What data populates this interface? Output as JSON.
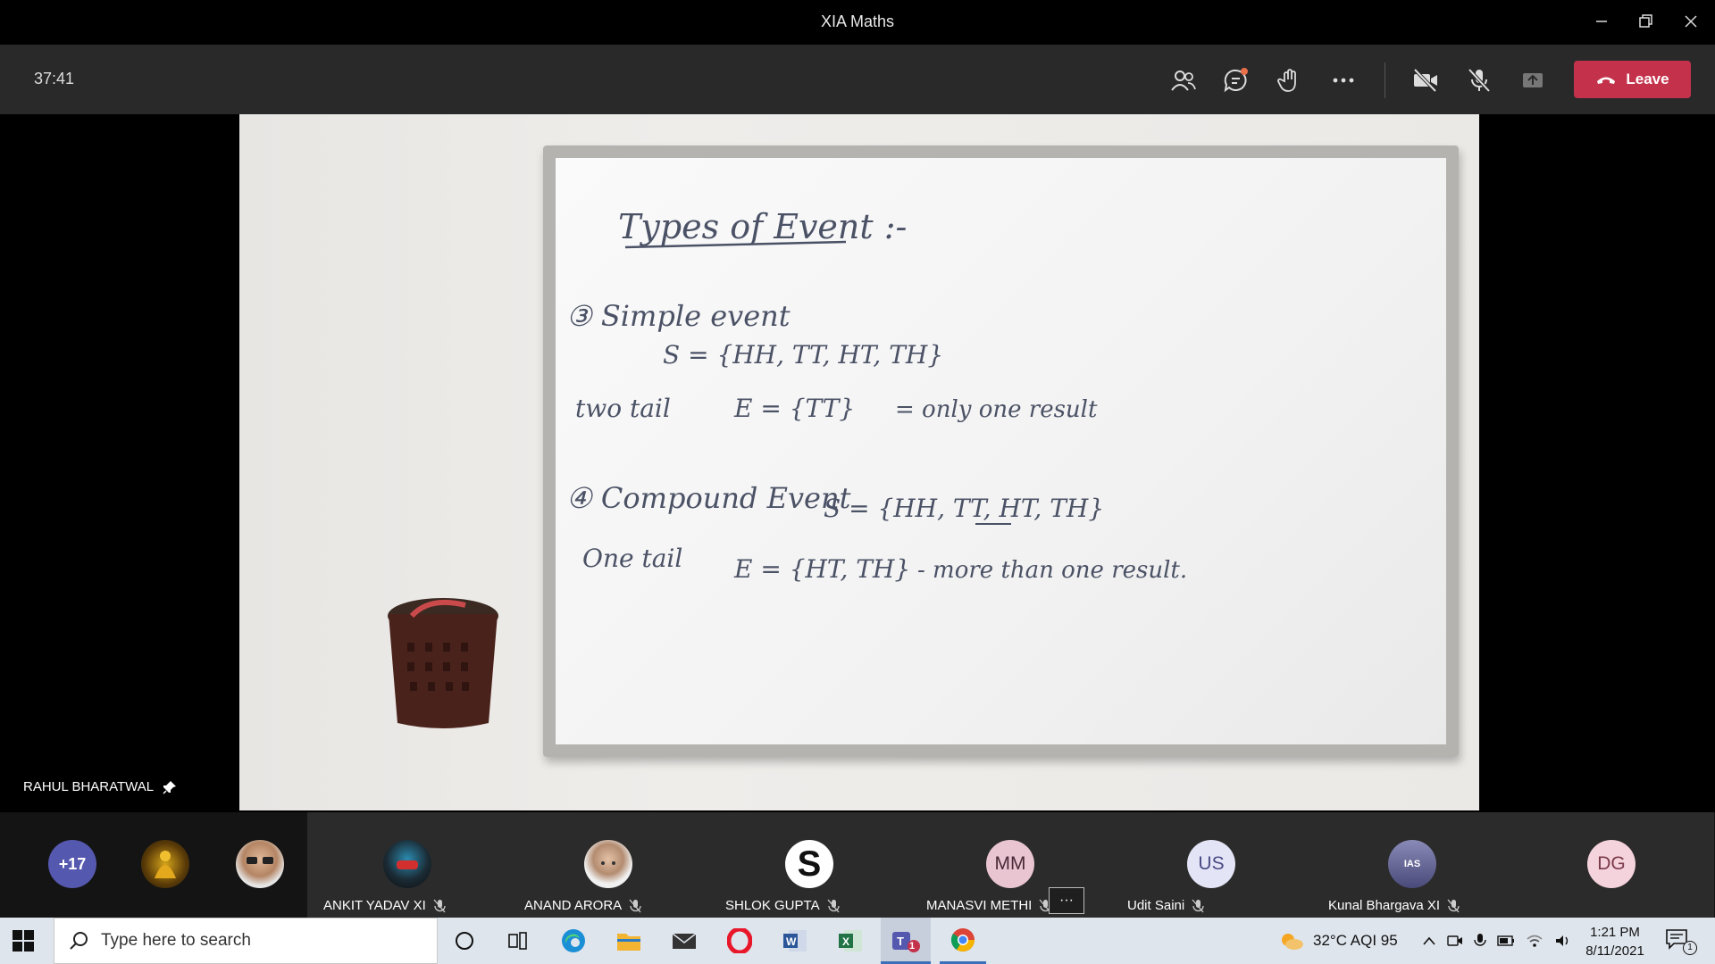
{
  "window": {
    "title": "XIA Maths"
  },
  "meeting": {
    "timer": "37:41",
    "leave_label": "Leave",
    "presenter_name": "RAHUL BHARATWAL"
  },
  "whiteboard": {
    "heading": "Types of Event :-",
    "line1": "③ Simple event",
    "line2": "S = {HH, TT, HT, TH}",
    "line3a": "two tail",
    "line3b": "E = {TT}",
    "line3c": "= only one result",
    "line4a": "④ Compound Event",
    "line4b": "S = {HH, TT, HT, TH}",
    "line5a": "One tail",
    "line5b": "E = {HT, TH}",
    "line5c": "- more than one result."
  },
  "participants": {
    "overflow_count": "+17",
    "tiles": [
      {
        "name": "ANKIT YADAV XI",
        "initials": ""
      },
      {
        "name": "ANAND ARORA",
        "initials": ""
      },
      {
        "name": "SHLOK GUPTA",
        "initials": "S"
      },
      {
        "name": "MANASVI METHI",
        "initials": "MM"
      },
      {
        "name": "Udit Saini",
        "initials": "US"
      },
      {
        "name": "Kunal Bhargava XI",
        "initials": "IAS"
      },
      {
        "name": "",
        "initials": "DG"
      }
    ],
    "more_label": "···"
  },
  "taskbar": {
    "search_placeholder": "Type here to search",
    "weather": "32°C  AQI 95",
    "time": "1:21 PM",
    "date": "8/11/2021",
    "notification_count": "1",
    "teams_badge": "1"
  },
  "colors": {
    "leave": "#c4314b",
    "toolbar": "#292929",
    "strip": "#2b2b2b",
    "accent": "#6264a7"
  }
}
